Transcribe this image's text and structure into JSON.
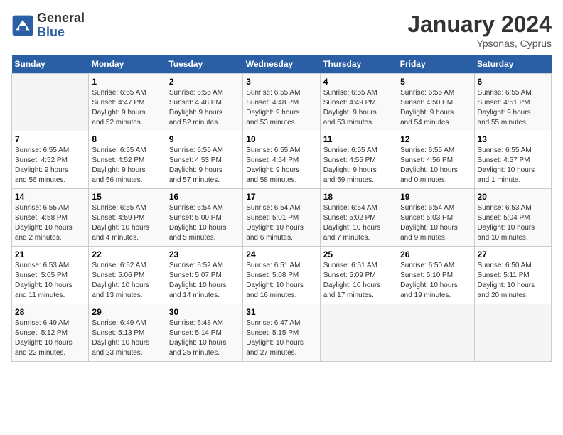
{
  "header": {
    "logo_general": "General",
    "logo_blue": "Blue",
    "month_title": "January 2024",
    "subtitle": "Ypsonas, Cyprus"
  },
  "weekdays": [
    "Sunday",
    "Monday",
    "Tuesday",
    "Wednesday",
    "Thursday",
    "Friday",
    "Saturday"
  ],
  "weeks": [
    [
      {
        "day": "",
        "info": ""
      },
      {
        "day": "1",
        "info": "Sunrise: 6:55 AM\nSunset: 4:47 PM\nDaylight: 9 hours\nand 52 minutes."
      },
      {
        "day": "2",
        "info": "Sunrise: 6:55 AM\nSunset: 4:48 PM\nDaylight: 9 hours\nand 52 minutes."
      },
      {
        "day": "3",
        "info": "Sunrise: 6:55 AM\nSunset: 4:48 PM\nDaylight: 9 hours\nand 53 minutes."
      },
      {
        "day": "4",
        "info": "Sunrise: 6:55 AM\nSunset: 4:49 PM\nDaylight: 9 hours\nand 53 minutes."
      },
      {
        "day": "5",
        "info": "Sunrise: 6:55 AM\nSunset: 4:50 PM\nDaylight: 9 hours\nand 54 minutes."
      },
      {
        "day": "6",
        "info": "Sunrise: 6:55 AM\nSunset: 4:51 PM\nDaylight: 9 hours\nand 55 minutes."
      }
    ],
    [
      {
        "day": "7",
        "info": "Sunrise: 6:55 AM\nSunset: 4:52 PM\nDaylight: 9 hours\nand 56 minutes."
      },
      {
        "day": "8",
        "info": "Sunrise: 6:55 AM\nSunset: 4:52 PM\nDaylight: 9 hours\nand 56 minutes."
      },
      {
        "day": "9",
        "info": "Sunrise: 6:55 AM\nSunset: 4:53 PM\nDaylight: 9 hours\nand 57 minutes."
      },
      {
        "day": "10",
        "info": "Sunrise: 6:55 AM\nSunset: 4:54 PM\nDaylight: 9 hours\nand 58 minutes."
      },
      {
        "day": "11",
        "info": "Sunrise: 6:55 AM\nSunset: 4:55 PM\nDaylight: 9 hours\nand 59 minutes."
      },
      {
        "day": "12",
        "info": "Sunrise: 6:55 AM\nSunset: 4:56 PM\nDaylight: 10 hours\nand 0 minutes."
      },
      {
        "day": "13",
        "info": "Sunrise: 6:55 AM\nSunset: 4:57 PM\nDaylight: 10 hours\nand 1 minute."
      }
    ],
    [
      {
        "day": "14",
        "info": "Sunrise: 6:55 AM\nSunset: 4:58 PM\nDaylight: 10 hours\nand 2 minutes."
      },
      {
        "day": "15",
        "info": "Sunrise: 6:55 AM\nSunset: 4:59 PM\nDaylight: 10 hours\nand 4 minutes."
      },
      {
        "day": "16",
        "info": "Sunrise: 6:54 AM\nSunset: 5:00 PM\nDaylight: 10 hours\nand 5 minutes."
      },
      {
        "day": "17",
        "info": "Sunrise: 6:54 AM\nSunset: 5:01 PM\nDaylight: 10 hours\nand 6 minutes."
      },
      {
        "day": "18",
        "info": "Sunrise: 6:54 AM\nSunset: 5:02 PM\nDaylight: 10 hours\nand 7 minutes."
      },
      {
        "day": "19",
        "info": "Sunrise: 6:54 AM\nSunset: 5:03 PM\nDaylight: 10 hours\nand 9 minutes."
      },
      {
        "day": "20",
        "info": "Sunrise: 6:53 AM\nSunset: 5:04 PM\nDaylight: 10 hours\nand 10 minutes."
      }
    ],
    [
      {
        "day": "21",
        "info": "Sunrise: 6:53 AM\nSunset: 5:05 PM\nDaylight: 10 hours\nand 11 minutes."
      },
      {
        "day": "22",
        "info": "Sunrise: 6:52 AM\nSunset: 5:06 PM\nDaylight: 10 hours\nand 13 minutes."
      },
      {
        "day": "23",
        "info": "Sunrise: 6:52 AM\nSunset: 5:07 PM\nDaylight: 10 hours\nand 14 minutes."
      },
      {
        "day": "24",
        "info": "Sunrise: 6:51 AM\nSunset: 5:08 PM\nDaylight: 10 hours\nand 16 minutes."
      },
      {
        "day": "25",
        "info": "Sunrise: 6:51 AM\nSunset: 5:09 PM\nDaylight: 10 hours\nand 17 minutes."
      },
      {
        "day": "26",
        "info": "Sunrise: 6:50 AM\nSunset: 5:10 PM\nDaylight: 10 hours\nand 19 minutes."
      },
      {
        "day": "27",
        "info": "Sunrise: 6:50 AM\nSunset: 5:11 PM\nDaylight: 10 hours\nand 20 minutes."
      }
    ],
    [
      {
        "day": "28",
        "info": "Sunrise: 6:49 AM\nSunset: 5:12 PM\nDaylight: 10 hours\nand 22 minutes."
      },
      {
        "day": "29",
        "info": "Sunrise: 6:49 AM\nSunset: 5:13 PM\nDaylight: 10 hours\nand 23 minutes."
      },
      {
        "day": "30",
        "info": "Sunrise: 6:48 AM\nSunset: 5:14 PM\nDaylight: 10 hours\nand 25 minutes."
      },
      {
        "day": "31",
        "info": "Sunrise: 6:47 AM\nSunset: 5:15 PM\nDaylight: 10 hours\nand 27 minutes."
      },
      {
        "day": "",
        "info": ""
      },
      {
        "day": "",
        "info": ""
      },
      {
        "day": "",
        "info": ""
      }
    ]
  ]
}
